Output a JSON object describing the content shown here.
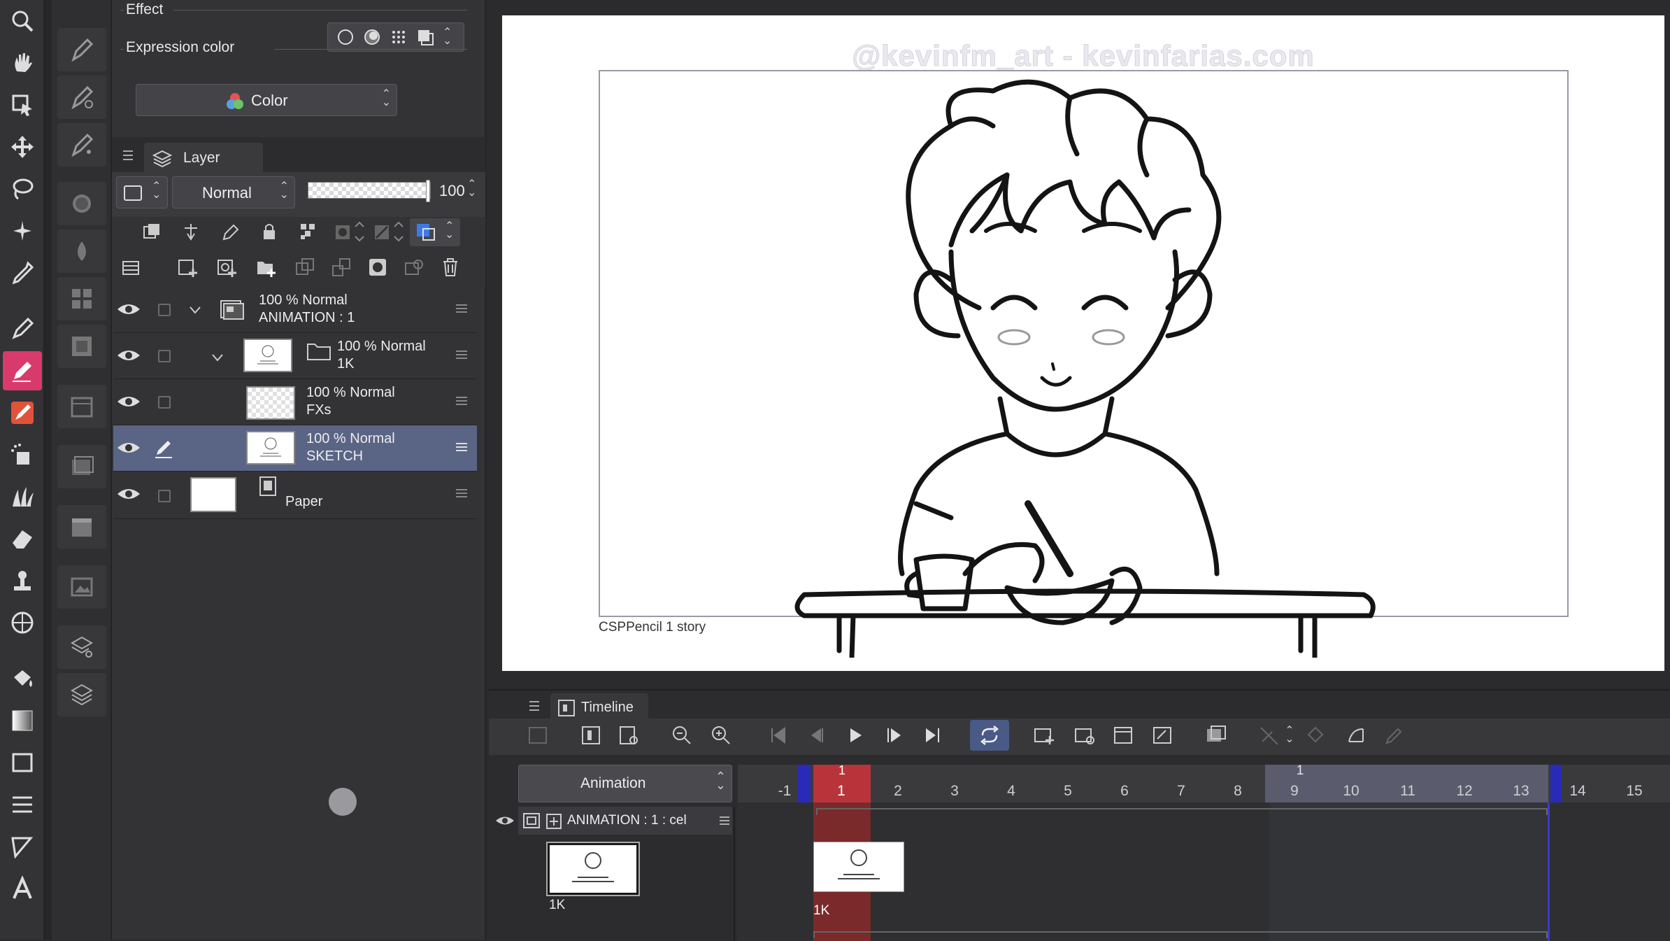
{
  "effect": {
    "label": "Effect"
  },
  "expression_color": {
    "label": "Expression color",
    "value": "Color"
  },
  "layer_panel": {
    "title": "Layer",
    "blend_mode": "Normal",
    "opacity": "100",
    "layers": [
      {
        "line1": "100 % Normal",
        "line2": "ANIMATION : 1"
      },
      {
        "line1": "100 % Normal",
        "line2": "1K"
      },
      {
        "line1": "100 % Normal",
        "line2": "FXs"
      },
      {
        "line1": "100 % Normal",
        "line2": "SKETCH"
      },
      {
        "line1": "",
        "line2": "Paper"
      }
    ]
  },
  "canvas": {
    "watermark": "@kevinfm_art - kevinfarias.com",
    "caption": "CSPPencil 1 story"
  },
  "timeline": {
    "title": "Timeline",
    "animation_select": "Animation",
    "track_label": "ANIMATION : 1 : cel",
    "cel_label": "1K",
    "frame_cel_label": "1K",
    "playhead_label": "1",
    "section_label": "1",
    "frame_numbers": [
      "-1",
      "1",
      "2",
      "3",
      "4",
      "5",
      "6",
      "7",
      "8",
      "9",
      "10",
      "11",
      "12",
      "13",
      "14",
      "15"
    ]
  }
}
